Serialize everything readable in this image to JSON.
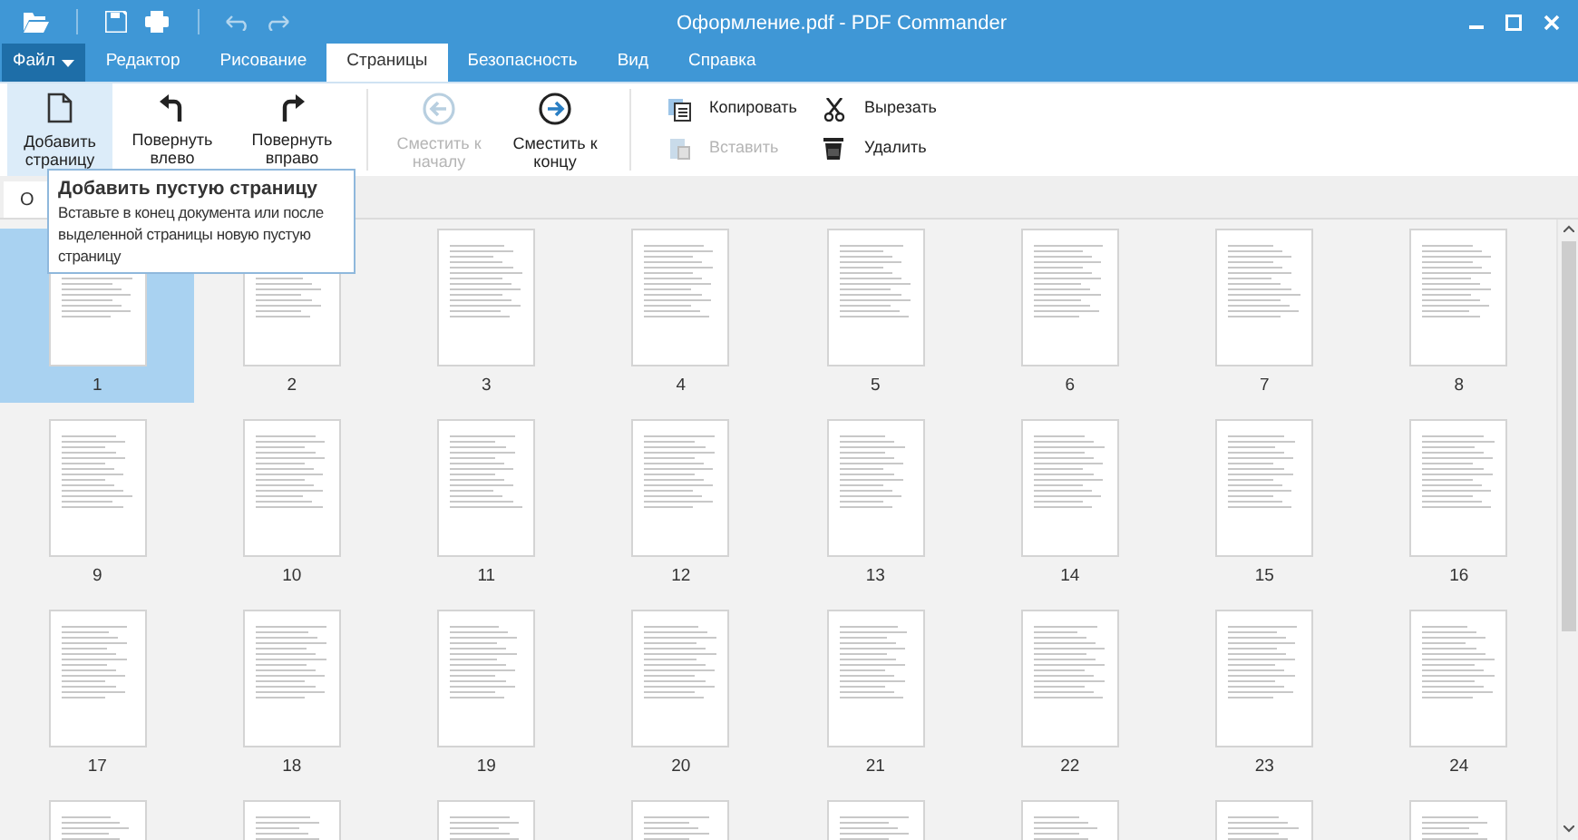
{
  "window": {
    "title": "Оформление.pdf - PDF Commander"
  },
  "menu_tabs": [
    {
      "label": "Файл",
      "kind": "file",
      "selected": false
    },
    {
      "label": "Редактор",
      "kind": "tab",
      "selected": false
    },
    {
      "label": "Рисование",
      "kind": "tab",
      "selected": false
    },
    {
      "label": "Страницы",
      "kind": "tab",
      "selected": true
    },
    {
      "label": "Безопасность",
      "kind": "tab",
      "selected": false
    },
    {
      "label": "Вид",
      "kind": "tab",
      "selected": false
    },
    {
      "label": "Справка",
      "kind": "tab",
      "selected": false
    }
  ],
  "ribbon": {
    "large_buttons": [
      {
        "label": "Добавить страницу",
        "disabled": false,
        "hovered": true
      },
      {
        "label": "Повернуть влево",
        "disabled": false,
        "hovered": false
      },
      {
        "label": "Повернуть вправо",
        "disabled": false,
        "hovered": false
      },
      {
        "label": "Сместить к началу",
        "disabled": true,
        "hovered": false
      },
      {
        "label": "Сместить к концу",
        "disabled": false,
        "hovered": false
      }
    ],
    "small_buttons": [
      {
        "label": "Копировать",
        "disabled": false
      },
      {
        "label": "Вставить",
        "disabled": true
      },
      {
        "label": "Вырезать",
        "disabled": false
      },
      {
        "label": "Удалить",
        "disabled": false
      }
    ]
  },
  "view_tab": {
    "label": "О"
  },
  "tooltip": {
    "title": "Добавить пустую страницу",
    "text": "Вставьте в конец документа или после выделенной страницы новую пустую страницу"
  },
  "pages": [
    {
      "number": "1",
      "selected": true
    },
    {
      "number": "2",
      "selected": false
    },
    {
      "number": "3",
      "selected": false
    },
    {
      "number": "4",
      "selected": false
    },
    {
      "number": "5",
      "selected": false
    },
    {
      "number": "6",
      "selected": false
    },
    {
      "number": "7",
      "selected": false
    },
    {
      "number": "8",
      "selected": false
    },
    {
      "number": "9",
      "selected": false
    },
    {
      "number": "10",
      "selected": false
    },
    {
      "number": "11",
      "selected": false
    },
    {
      "number": "12",
      "selected": false
    },
    {
      "number": "13",
      "selected": false
    },
    {
      "number": "14",
      "selected": false
    },
    {
      "number": "15",
      "selected": false
    },
    {
      "number": "16",
      "selected": false
    },
    {
      "number": "17",
      "selected": false
    },
    {
      "number": "18",
      "selected": false
    },
    {
      "number": "19",
      "selected": false
    },
    {
      "number": "20",
      "selected": false
    },
    {
      "number": "21",
      "selected": false
    },
    {
      "number": "22",
      "selected": false
    },
    {
      "number": "23",
      "selected": false
    },
    {
      "number": "24",
      "selected": false
    },
    {
      "selected": false
    },
    {
      "selected": false
    },
    {
      "selected": false
    },
    {
      "selected": false
    },
    {
      "selected": false
    },
    {
      "selected": false
    },
    {
      "selected": false
    },
    {
      "selected": false
    }
  ]
}
